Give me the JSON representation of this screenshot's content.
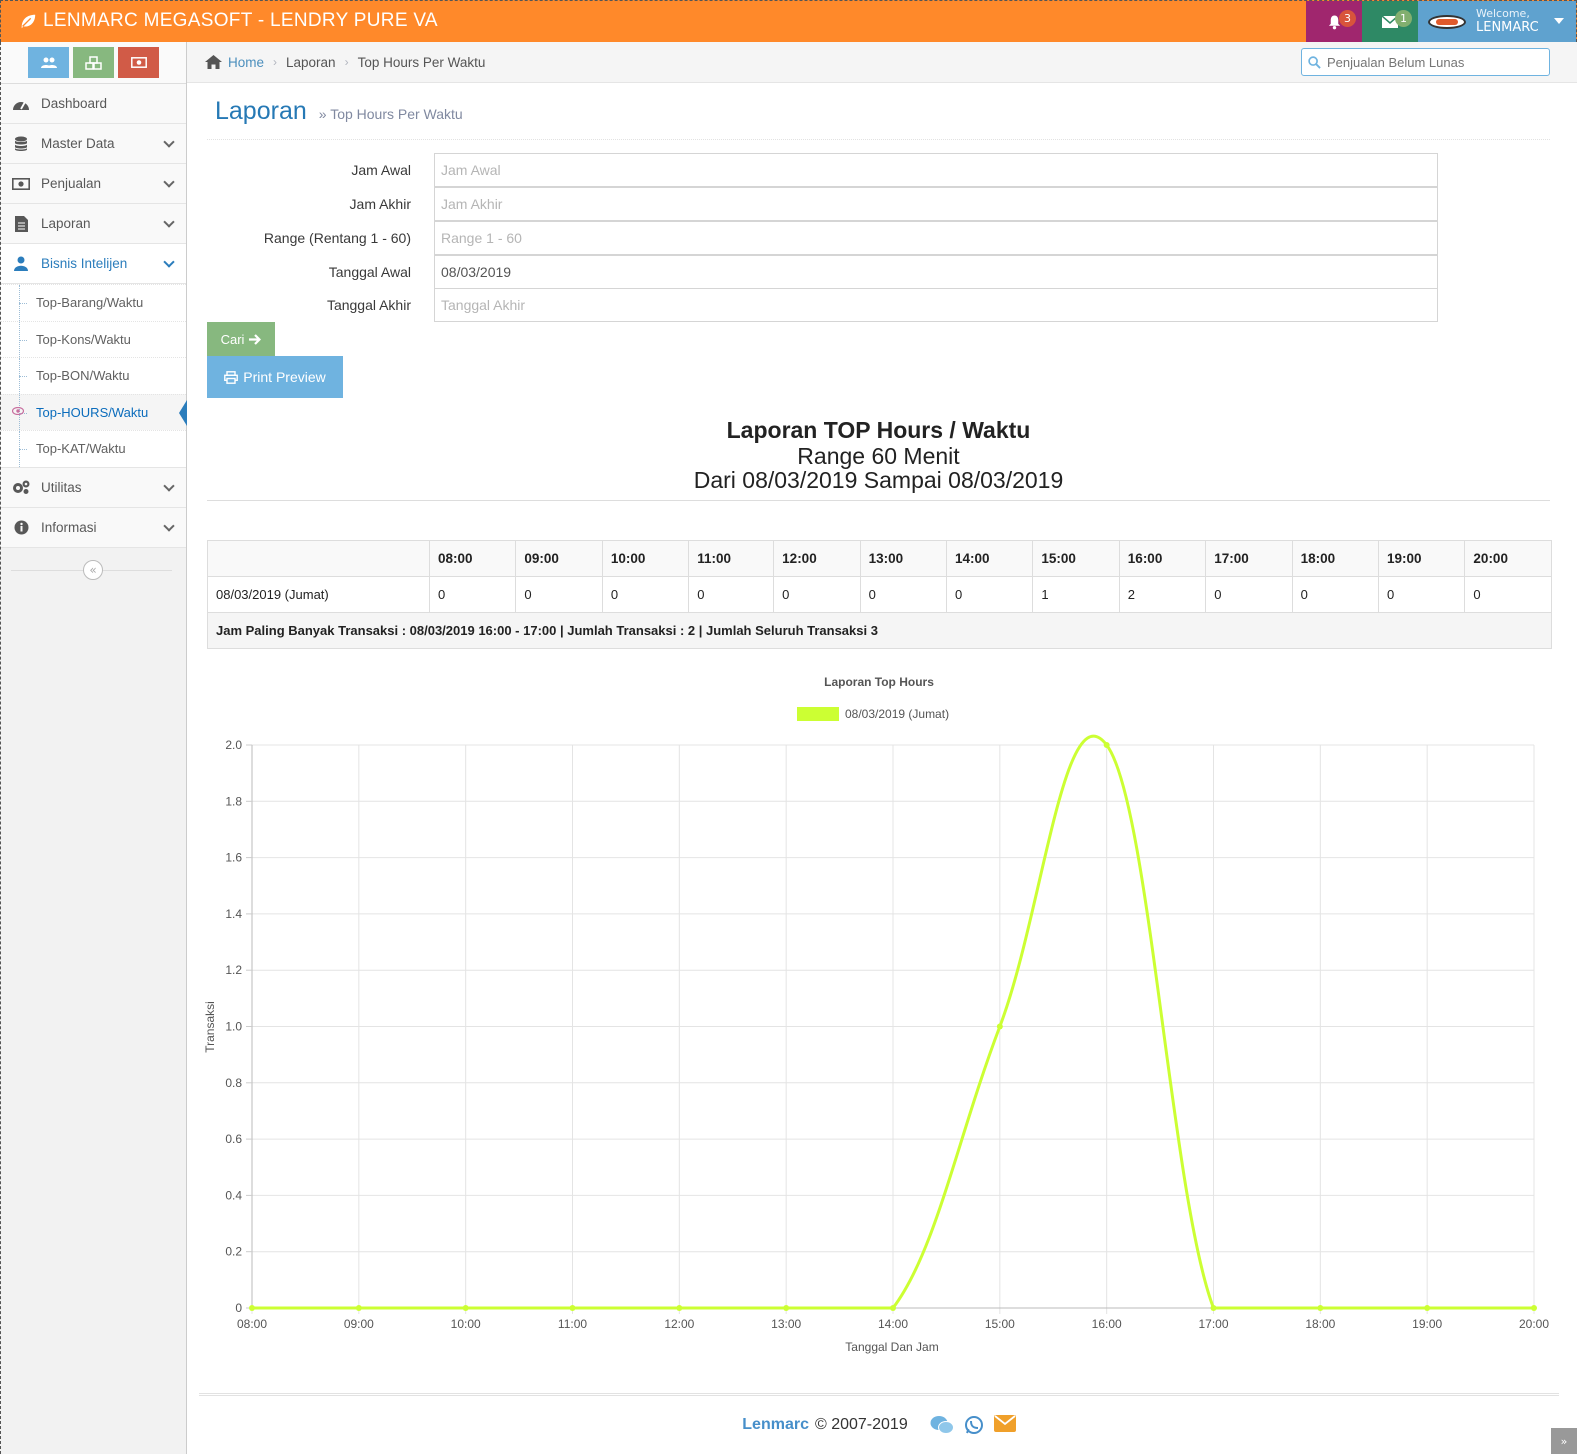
{
  "app": {
    "brand": "LENMARC MEGASOFT - LENDRY PURE VA",
    "notif_count": "3",
    "mail_count": "1",
    "welcome": "Welcome,",
    "user": "LENMARC"
  },
  "sidebar": {
    "items": [
      {
        "label": "Dashboard",
        "icon": "tachometer-icon"
      },
      {
        "label": "Master Data",
        "icon": "database-icon"
      },
      {
        "label": "Penjualan",
        "icon": "money-icon"
      },
      {
        "label": "Laporan",
        "icon": "file-icon"
      },
      {
        "label": "Bisnis Intelijen",
        "icon": "user-icon"
      },
      {
        "label": "Utilitas",
        "icon": "cogs-icon"
      },
      {
        "label": "Informasi",
        "icon": "info-icon"
      }
    ],
    "sub_items": [
      "Top-Barang/Waktu",
      "Top-Kons/Waktu",
      "Top-BON/Waktu",
      "Top-HOURS/Waktu",
      "Top-KAT/Waktu"
    ]
  },
  "breadcrumb": {
    "home": "Home",
    "level1": "Laporan",
    "current": "Top Hours Per Waktu",
    "search_placeholder": "Penjualan Belum Lunas"
  },
  "header": {
    "title": "Laporan",
    "subtitle": "Top Hours Per Waktu"
  },
  "form": {
    "jam_awal_label": "Jam Awal",
    "jam_awal_placeholder": "Jam Awal",
    "jam_akhir_label": "Jam Akhir",
    "jam_akhir_placeholder": "Jam Akhir",
    "range_label": "Range (Rentang 1 - 60)",
    "range_placeholder": "Range 1 - 60",
    "tgl_awal_label": "Tanggal Awal",
    "tgl_awal_value": "08/03/2019",
    "tgl_akhir_label": "Tanggal Akhir",
    "tgl_akhir_placeholder": "Tanggal Akhir",
    "cari_label": "Cari",
    "print_label": "Print Preview"
  },
  "report": {
    "title": "Laporan TOP Hours / Waktu",
    "range": "Range 60 Menit",
    "period": "Dari 08/03/2019 Sampai 08/03/2019"
  },
  "table": {
    "hours": [
      "08:00",
      "09:00",
      "10:00",
      "11:00",
      "12:00",
      "13:00",
      "14:00",
      "15:00",
      "16:00",
      "17:00",
      "18:00",
      "19:00",
      "20:00"
    ],
    "row_label": "08/03/2019 (Jumat)",
    "values": [
      "0",
      "0",
      "0",
      "0",
      "0",
      "0",
      "0",
      "1",
      "2",
      "0",
      "0",
      "0",
      "0"
    ],
    "summary": "Jam Paling Banyak Transaksi : 08/03/2019 16:00 - 17:00 | Jumlah Transaksi : 2 | Jumlah Seluruh Transaksi 3"
  },
  "chart_data": {
    "type": "line",
    "title": "Laporan Top Hours",
    "xlabel": "Tanggal Dan Jam",
    "ylabel": "Transaksi",
    "x": [
      "08:00",
      "09:00",
      "10:00",
      "11:00",
      "12:00",
      "13:00",
      "14:00",
      "15:00",
      "16:00",
      "17:00",
      "18:00",
      "19:00",
      "20:00"
    ],
    "series": [
      {
        "name": "08/03/2019 (Jumat)",
        "values": [
          0,
          0,
          0,
          0,
          0,
          0,
          0,
          1,
          2,
          0,
          0,
          0,
          0
        ],
        "color": "#ccff33"
      }
    ],
    "yticks": [
      "0",
      "0.2",
      "0.4",
      "0.6",
      "0.8",
      "1.0",
      "1.2",
      "1.4",
      "1.6",
      "1.8",
      "2.0"
    ],
    "ylim": [
      0,
      2.0
    ],
    "grid": true,
    "legend": "top"
  },
  "footer": {
    "brand": "Lenmarc",
    "copyright": "© 2007-2019"
  }
}
